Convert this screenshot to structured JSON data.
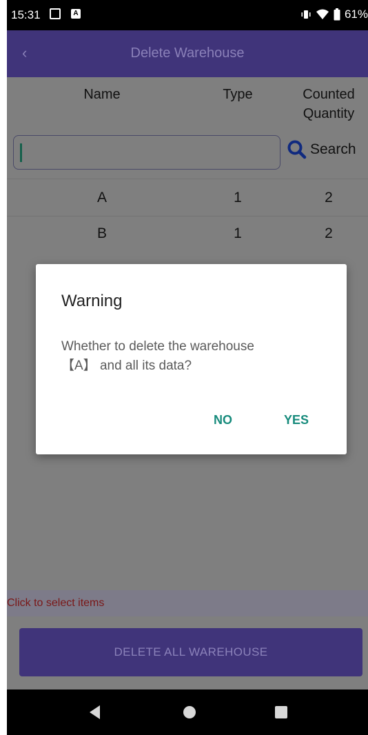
{
  "status_bar": {
    "time": "15:31",
    "battery": "61%"
  },
  "app_bar": {
    "title": "Delete Warehouse",
    "back_icon": "‹"
  },
  "table": {
    "headers": {
      "name": "Name",
      "type": "Type",
      "counted_quantity_line1": "Counted",
      "counted_quantity_line2": "Quantity"
    },
    "rows": [
      {
        "name": "A",
        "type": "1",
        "counted_quantity": "2"
      },
      {
        "name": "B",
        "type": "1",
        "counted_quantity": "2"
      }
    ]
  },
  "search": {
    "value": "",
    "button_label": "Search"
  },
  "hint_text": "Click to select items",
  "delete_all_label": "DELETE ALL WAREHOUSE",
  "dialog": {
    "title": "Warning",
    "message_line1": "Whether to delete the warehouse",
    "message_line2": "【A】 and all its data?",
    "no_label": "NO",
    "yes_label": "YES"
  },
  "colors": {
    "app_bar": "#40347a",
    "accent": "#178b7c",
    "hint_text": "#7a1717"
  }
}
